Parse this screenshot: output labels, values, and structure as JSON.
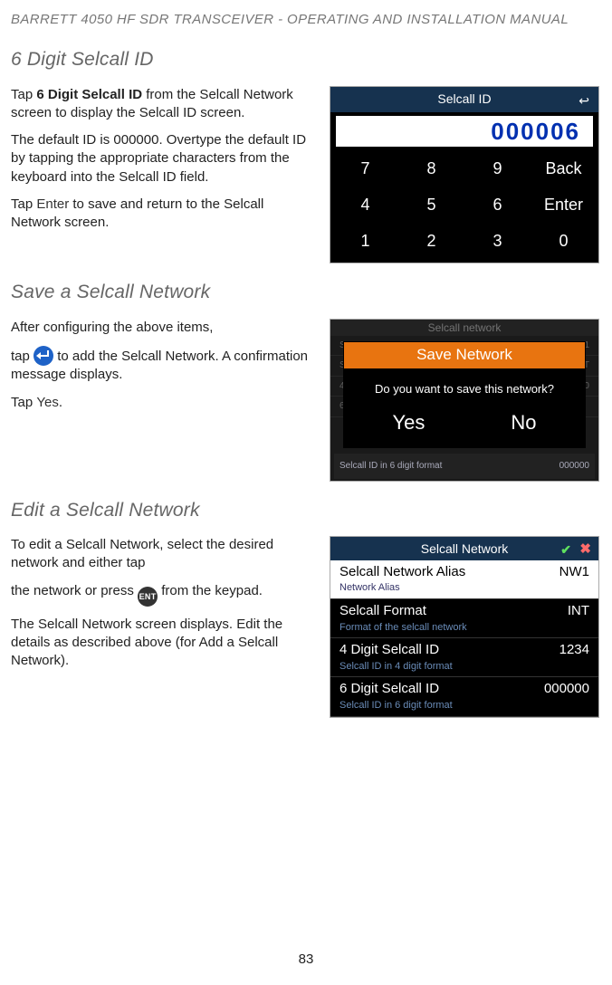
{
  "header": "BARRETT 4050 HF SDR TRANSCEIVER - OPERATING AND INSTALLATION MANUAL",
  "page_number": "83",
  "sec1": {
    "heading": "6 Digit Selcall ID",
    "p1a": "Tap ",
    "p1b": "6 Digit Selcall ID",
    "p1c": " from the Selcall Network screen to display the Selcall ID screen.",
    "p2": "The default ID is 000000. Overtype the default ID by tapping the appro­priate characters from the keyboard into the Selcall ID field.",
    "p3a": "Tap ",
    "p3b": "Enter",
    "p3c": " to save and return to the Selcall Network screen."
  },
  "sidshot": {
    "title": "Selcall ID",
    "value": "000006",
    "keys": [
      "7",
      "8",
      "9",
      "Back",
      "4",
      "5",
      "6",
      "Enter",
      "1",
      "2",
      "3",
      "0"
    ]
  },
  "sec2": {
    "heading": "Save a Selcall Network",
    "p1": "After configuring the above items,",
    "p2a": "tap ",
    "p2b": " to add the Selcall Network. A confirmation message displays.",
    "p3a": "Tap ",
    "p3b": "Yes",
    "p3c": "."
  },
  "saveshot": {
    "bg_title": "Selcall network",
    "dialog_title": "Save Network",
    "dialog_msg": "Do you want to save this network?",
    "yes": "Yes",
    "no": "No",
    "bg_bottom_left": "Selcall ID in 6 digit format",
    "bg_bottom_right": "000000"
  },
  "sec3": {
    "heading": "Edit a Selcall Network",
    "p1": "To edit a Selcall Network, select the desired network and either tap",
    "p2a": "the network or press ",
    "p2b": " from the keypad.",
    "p3": "The Selcall Network screen displays. Edit the details as described above (for Add a Selcall Network)."
  },
  "netshot": {
    "title": "Selcall Network",
    "rows": [
      {
        "label": "Selcall Network Alias",
        "sub": "Network Alias",
        "value": "NW1",
        "hl": true
      },
      {
        "label": "Selcall Format",
        "sub": "Format of the selcall network",
        "value": "INT",
        "hl": false
      },
      {
        "label": "4 Digit Selcall ID",
        "sub": "Selcall ID in 4 digit format",
        "value": "1234",
        "hl": false
      },
      {
        "label": "6 Digit Selcall ID",
        "sub": "Selcall ID in 6 digit format",
        "value": "000000",
        "hl": false
      }
    ]
  },
  "ent_label": "ENT"
}
